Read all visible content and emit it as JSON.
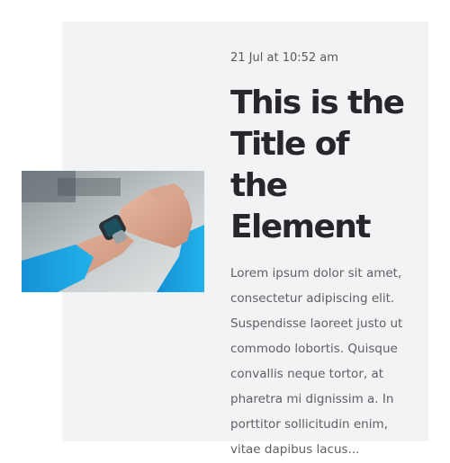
{
  "post": {
    "date": "21 Jul at 10:52 am",
    "title": "This is the Title of the Element",
    "excerpt": "Lorem ipsum dolor sit amet, consectetur adipiscing elit. Suspendisse laoreet justo ut commodo lobortis. Quisque convallis neque tortor, at pharetra mi dignissim a. In porttitor sollicitudin enim, vitae dapibus lacus...",
    "image_icon": "smartwatch-photo"
  },
  "colors": {
    "card_background": "#f2f3f5",
    "title": "#26272b",
    "body_text": "#5f6063",
    "sleeve_blue": "#1ea3e3"
  }
}
